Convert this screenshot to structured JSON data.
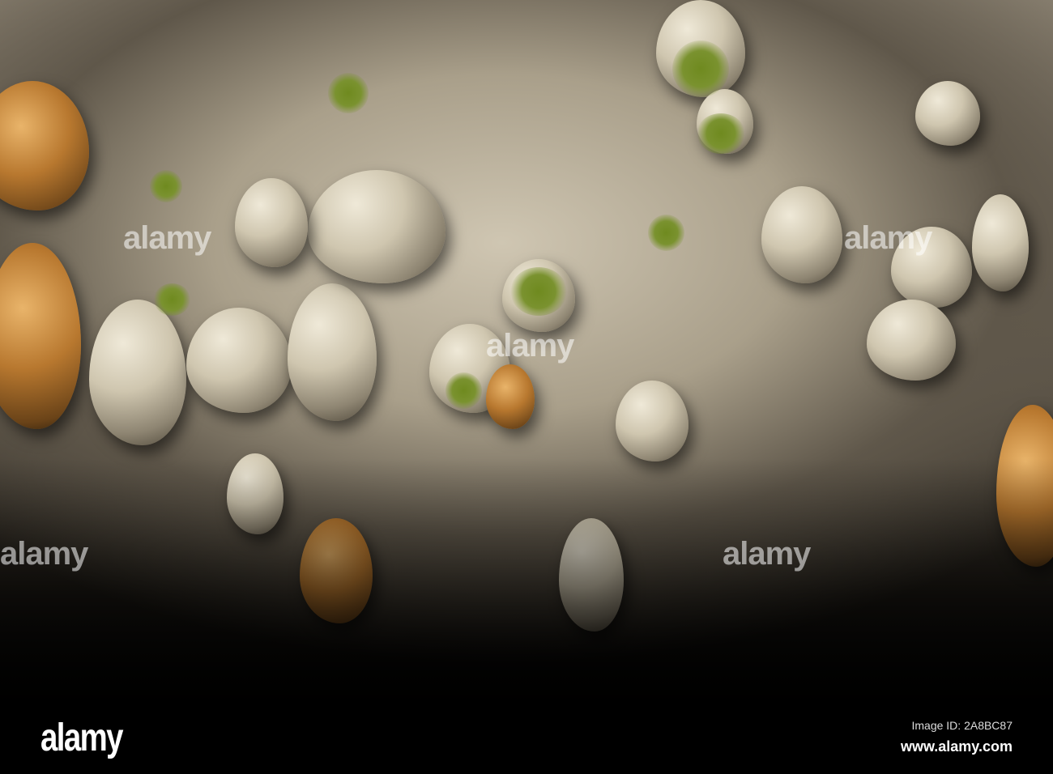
{
  "watermark": {
    "text": "alamy"
  },
  "footer": {
    "logo": "alamy",
    "image_id": "Image ID: 2A8BC87",
    "website": "www.alamy.com"
  }
}
